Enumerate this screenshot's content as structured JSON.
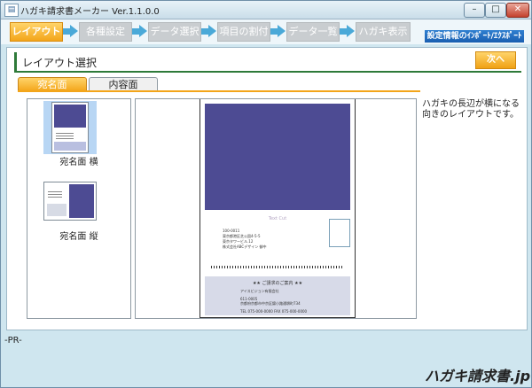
{
  "window": {
    "title": "ハガキ請求書メーカー Ver.1.1.0.0",
    "min": "–",
    "max": "□",
    "close": "✕"
  },
  "steps": [
    {
      "label": "レイアウト",
      "active": true
    },
    {
      "label": "各種設定",
      "active": false
    },
    {
      "label": "データ選択",
      "active": false
    },
    {
      "label": "項目の割付",
      "active": false
    },
    {
      "label": "データ一覧",
      "active": false
    },
    {
      "label": "ハガキ表示",
      "active": false
    }
  ],
  "save_load_label": "設定情報のｲﾝﾎﾟｰﾄ/ｴｸｽﾎﾟｰﾄ",
  "section": {
    "title": "レイアウト選択",
    "next_label": "次へ >>>"
  },
  "tabs": [
    {
      "label": "宛名面"
    },
    {
      "label": "内容面"
    }
  ],
  "layouts": [
    {
      "label": "宛名面 横"
    },
    {
      "label": "宛名面 縦"
    }
  ],
  "preview": {
    "face_text": "Text Cut",
    "addr_lines": [
      "100-0011",
      "東京都港区芝公園4-5-5",
      "東京タワービル.12",
      "株式会社ABCデザイン 御中"
    ],
    "footer_heading": "★★ ご請求のご案内 ★★",
    "footer_lines": [
      "アイスビジョン有限会社",
      "",
      "611-0005",
      "京都府京都市中京区錦小路通堺町734",
      "",
      "TEL 075-000-0000    FAX 075-000-0000"
    ]
  },
  "description": "ハガキの長辺が横になる向きのレイアウトです。",
  "pr_label": "-PR-",
  "logo_text": "ハガキ請求書.jp"
}
